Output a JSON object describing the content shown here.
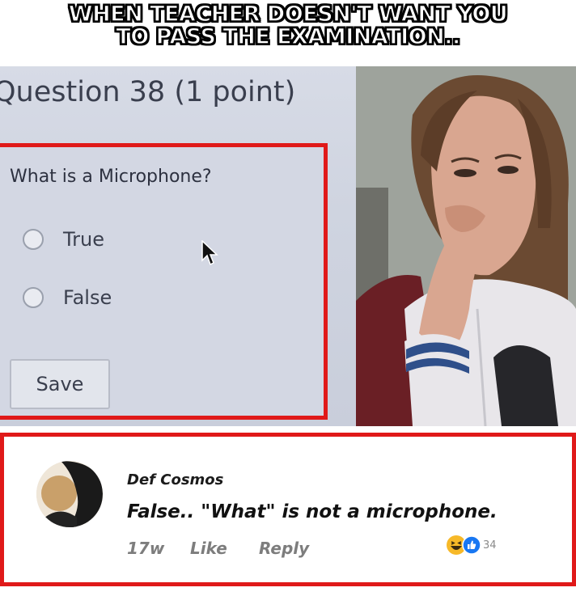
{
  "caption": {
    "line1": "WHEN TEACHER DOESN'T WANT YOU",
    "line2": "TO PASS THE EXAMINATION.."
  },
  "quiz": {
    "title": "Question 38 (1 point)",
    "question": "What is a Microphone?",
    "options": [
      "True",
      "False"
    ],
    "save_label": "Save"
  },
  "comment": {
    "author": "Def Cosmos",
    "text": "False.. \"What\" is not a microphone.",
    "time": "17w",
    "like_label": "Like",
    "reply_label": "Reply",
    "reaction_count": "34"
  },
  "colors": {
    "highlight_border": "#e01919",
    "like_blue": "#1877f2",
    "haha_yellow": "#f7b928"
  }
}
